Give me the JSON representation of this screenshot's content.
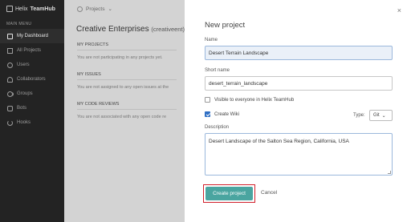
{
  "sidebar": {
    "brand_plain": "Helix",
    "brand_bold": "TeamHub",
    "menu_title": "MAIN MENU",
    "items": [
      {
        "label": "My Dashboard",
        "icon": "home-icon"
      },
      {
        "label": "All Projects",
        "icon": "projects-icon"
      },
      {
        "label": "Users",
        "icon": "user-icon"
      },
      {
        "label": "Collaborators",
        "icon": "collaborators-icon"
      },
      {
        "label": "Groups",
        "icon": "groups-icon"
      },
      {
        "label": "Bots",
        "icon": "bot-icon"
      },
      {
        "label": "Hooks",
        "icon": "hook-icon"
      }
    ]
  },
  "main": {
    "projects_dropdown": "Projects",
    "org_name": "Creative Enterprises",
    "org_handle": "(creativeent)",
    "sections": [
      {
        "title": "MY PROJECTS",
        "message": "You are not participating in any projects yet."
      },
      {
        "title": "MY ISSUES",
        "message": "You are not assigned to any open issues at the"
      },
      {
        "title": "MY CODE REVIEWS",
        "message": "You are not associated with any open code re"
      }
    ]
  },
  "modal": {
    "title": "New project",
    "name_label": "Name",
    "name_value": "Desert Terrain Landscape",
    "short_name_label": "Short name",
    "short_name_value": "desert_terrain_landscape",
    "visible_label": "Visible to everyone in Helix TeamHub",
    "visible_checked": false,
    "create_wiki_label": "Create Wiki",
    "create_wiki_checked": true,
    "type_label": "Type:",
    "type_value": "Git",
    "description_label": "Description",
    "description_value": "Desert Landscape of the Salton Sea Region, California, USA",
    "create_button": "Create project",
    "cancel_button": "Cancel",
    "close_symbol": "×"
  },
  "colors": {
    "sidebar_bg": "#232323",
    "create_button_bg": "#4aa5a0",
    "highlight_border": "#d11f2b",
    "checkbox_checked": "#2f6fc4"
  }
}
